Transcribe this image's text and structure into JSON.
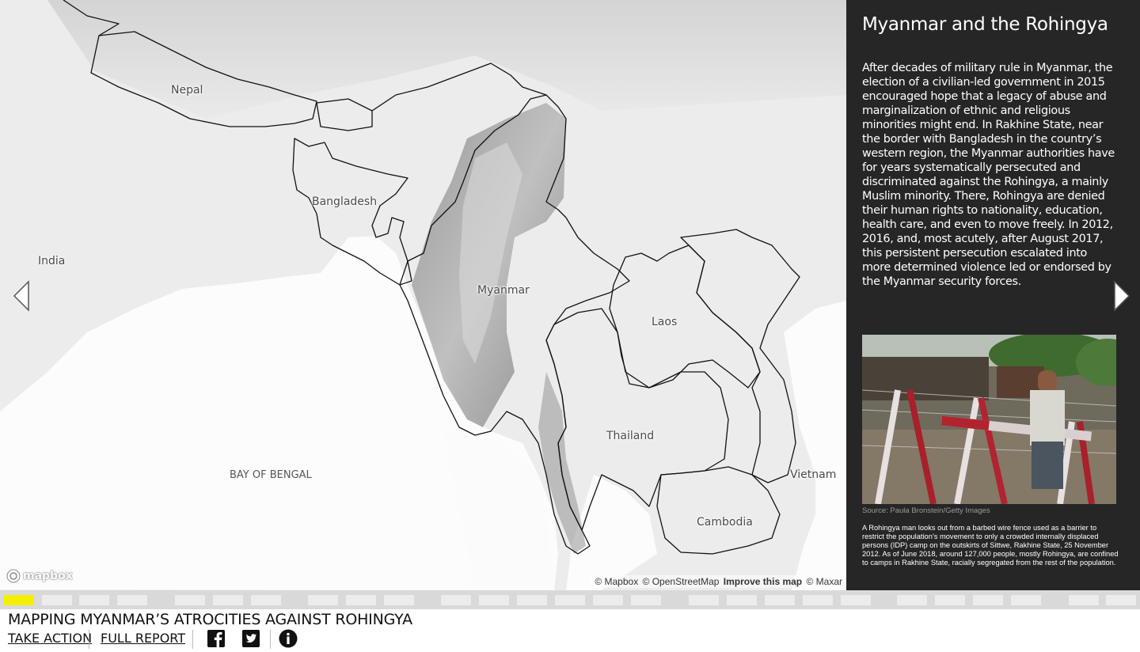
{
  "map": {
    "labels": {
      "nepal": "Nepal",
      "bangladesh": "Bangladesh",
      "india": "India",
      "myanmar": "Myanmar",
      "laos": "Laos",
      "thailand": "Thailand",
      "vietnam": "Vietnam",
      "cambodia": "Cambodia",
      "bay_of_bengal": "BAY OF BENGAL"
    },
    "logo_text": "mapbox",
    "attribution": {
      "mapbox": "© Mapbox",
      "osm": "© OpenStreetMap",
      "improve": "Improve this map",
      "maxar": "© Maxar"
    },
    "arrows": {
      "prev_icon": "chevron-left-icon",
      "next_icon": "chevron-right-icon"
    }
  },
  "panel": {
    "title": "Myanmar and the Rohingya",
    "body": "After decades of military rule in Myanmar, the election of a civilian-led government in 2015 encouraged hope that a legacy of abuse and marginalization of ethnic and religious minorities might end. In Rakhine State, near the border with Bangladesh in the country’s western region, the Myanmar authorities have for years systematically persecuted and discriminated against the Rohingya, a mainly Muslim minority. There, Rohingya are denied their human rights to nationality, education, health care, and even to move freely. In 2012, 2016, and, most acutely, after August 2017, this persistent persecution escalated into more determined violence led or endorsed by the Myanmar security forces.",
    "photo_source": "Source: Paula Bronstein/Getty Images",
    "photo_caption": "A Rohingya man looks out from a barbed wire fence used as a barrier to restrict the population’s movement to only a crowded internally displaced persons (IDP) camp on the outskirts of Sittwe, Rakhine State, 25 November 2012. As of June 2018, around 127,000 people, mostly Rohingya, are confined to camps in Rakhine State, racially segregated from the rest of the population."
  },
  "progress": {
    "total_segments": 27,
    "active_segment": 1,
    "active_color": "#f4f000"
  },
  "footer": {
    "title": "MAPPING MYANMAR’S ATROCITIES AGAINST ROHINGYA",
    "take_action": "TAKE ACTION",
    "full_report": "FULL REPORT",
    "icons": [
      "facebook-icon",
      "twitter-icon",
      "info-icon"
    ]
  },
  "colors": {
    "panel_bg": "#262626",
    "map_land": "#ececec",
    "sea": "#fcfcfc",
    "border": "#111111"
  }
}
